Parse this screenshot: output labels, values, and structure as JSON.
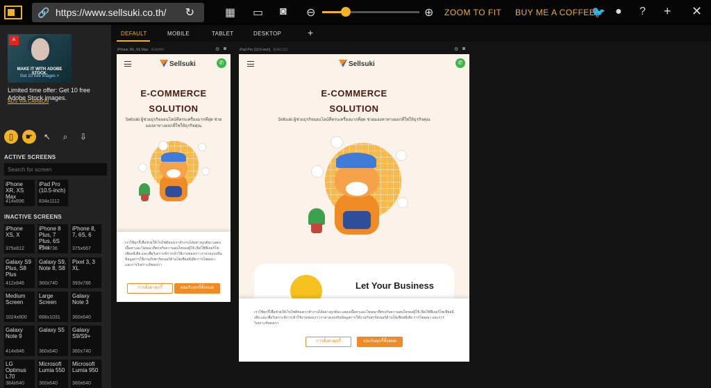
{
  "toolbar": {
    "url": "https://www.sellsuki.co.th/",
    "zoom_to_fit": "ZOOM TO FIT",
    "buy_coffee": "BUY ME A COFFEE",
    "zoom_level": 0.27,
    "accent_color": "#f1b324",
    "icons": [
      "logo-icon",
      "link-icon",
      "reload-icon",
      "grid-icon",
      "device-icon",
      "camera-icon",
      "zoom-out-icon",
      "zoom-in-icon",
      "twitter-icon",
      "github-icon",
      "help-icon",
      "plus-icon",
      "close-icon"
    ]
  },
  "ad": {
    "image_line1": "MAKE IT WITH ADOBE STOCK.",
    "image_line2": "Get 10 free images >",
    "text": "Limited time offer: Get 10 free Adobe Stock images.",
    "via": "ADS VIA CARBON"
  },
  "sidebar": {
    "active_title": "ACTIVE SCREENS",
    "search_placeholder": "Search for screen",
    "inactive_title": "INACTIVE SCREENS",
    "active": [
      {
        "name": "iPhone XR, XS Max",
        "dims": "414x896"
      },
      {
        "name": "iPad Pro (10.5-inch)",
        "dims": "834x1112"
      }
    ],
    "inactive": [
      {
        "name": "iPhone XS, X",
        "dims": "375x812"
      },
      {
        "name": "iPhone 8 Plus, 7 Plus, 6S Plus",
        "dims": "414x736"
      },
      {
        "name": "iPhone 8, 7, 6S, 6",
        "dims": "375x667"
      },
      {
        "name": "Galaxy S9 Plus, S8 Plus",
        "dims": "412x846"
      },
      {
        "name": "Galaxy S9, Note 8, S8",
        "dims": "360x740"
      },
      {
        "name": "Pixel 3, 3 XL",
        "dims": "393x786"
      },
      {
        "name": "Medium Screen",
        "dims": "1024x800"
      },
      {
        "name": "Large Screen",
        "dims": "688x1031"
      },
      {
        "name": "Galaxy Note 3",
        "dims": "360x640"
      },
      {
        "name": "Galaxy Note 9",
        "dims": "414x846"
      },
      {
        "name": "Galaxy S5",
        "dims": "360x640"
      },
      {
        "name": "Galaxy S9/S9+",
        "dims": "360x740"
      },
      {
        "name": "LG Optimus L70",
        "dims": "384x640"
      },
      {
        "name": "Microsoft Lumia 550",
        "dims": "360x640"
      },
      {
        "name": "Microsoft Lumia 950",
        "dims": "360x640"
      }
    ]
  },
  "tabs": [
    "DEFAULT",
    "MOBILE",
    "TABLET",
    "DESKTOP"
  ],
  "screens": {
    "phone": {
      "label": "iPhone XR, XS Max",
      "dims": "414x896"
    },
    "tablet": {
      "label": "iPad Pro (10.5-inch)",
      "dims": "834x1112"
    }
  },
  "site": {
    "brand": "Sellsuki",
    "title_line1": "E-COMMERCE",
    "title_line2": "SOLUTION",
    "subtitle": "Sellsuki ผู้ช่วยธุรกิจออนไลน์ที่ครบเครื่องมากที่สุด ช่วยมองหาทางออกที่ใช่ให้ธุรกิจคุณ",
    "card_title": "Let Your Business",
    "cookie_text": "เราใช้คุกกี้เพื่อช่วยให้เว็บไซต์ของเราทำงานได้อย่างถูกต้อง แสดงเนื้อหาและโฆษณาที่ตรงกับความสนใจของผู้ใช้ เปิดใช้ฟีเจอร์โซเชียลมีเดีย และเพื่อวิเคราะห์การเข้าใช้งานของเรา เราอาจแบ่งปันข้อมูลการใช้งานกับพาร์ทเนอร์ด้านโซเชียลมีเดีย การโฆษณา และการวิเคราะห์ของเรา",
    "cookie_settings": "การตั้งค่าคุกกี้",
    "cookie_accept": "ยอมรับคุกกี้ทั้งหมด",
    "brand_orange": "#f08a24",
    "brand_blue": "#2f6fd1"
  }
}
